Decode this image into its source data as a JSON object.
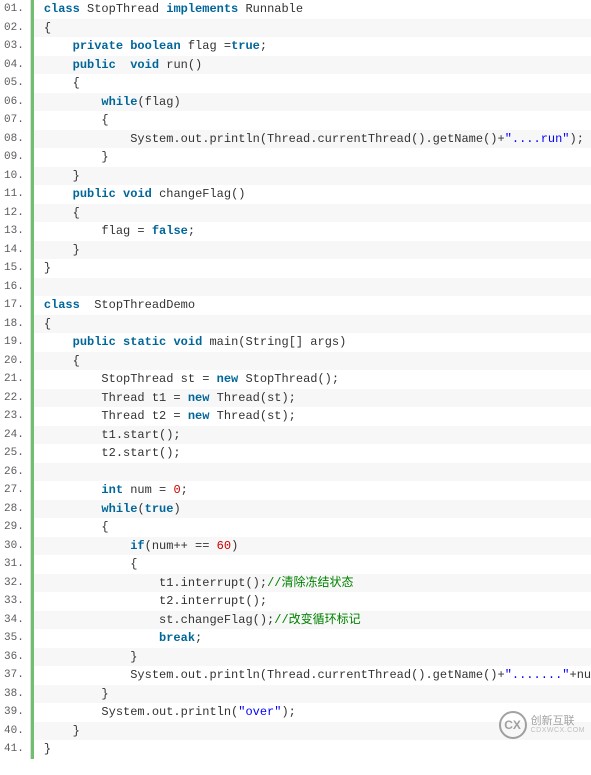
{
  "lines": [
    {
      "n": "01.",
      "tokens": [
        {
          "t": "class ",
          "c": "kw"
        },
        {
          "t": "StopThread ",
          "c": "cls"
        },
        {
          "t": "implements ",
          "c": "kw"
        },
        {
          "t": "Runnable",
          "c": "cls"
        }
      ]
    },
    {
      "n": "02.",
      "tokens": [
        {
          "t": "{",
          "c": ""
        }
      ]
    },
    {
      "n": "03.",
      "tokens": [
        {
          "t": "    ",
          "c": ""
        },
        {
          "t": "private ",
          "c": "kw"
        },
        {
          "t": "boolean ",
          "c": "type"
        },
        {
          "t": "flag =",
          "c": ""
        },
        {
          "t": "true",
          "c": "kw"
        },
        {
          "t": ";",
          "c": ""
        }
      ]
    },
    {
      "n": "04.",
      "tokens": [
        {
          "t": "    ",
          "c": ""
        },
        {
          "t": "public  ",
          "c": "kw"
        },
        {
          "t": "void ",
          "c": "type"
        },
        {
          "t": "run()",
          "c": ""
        }
      ]
    },
    {
      "n": "05.",
      "tokens": [
        {
          "t": "    {",
          "c": ""
        }
      ]
    },
    {
      "n": "06.",
      "tokens": [
        {
          "t": "        ",
          "c": ""
        },
        {
          "t": "while",
          "c": "kw"
        },
        {
          "t": "(flag)",
          "c": ""
        }
      ]
    },
    {
      "n": "07.",
      "tokens": [
        {
          "t": "        {",
          "c": ""
        }
      ]
    },
    {
      "n": "08.",
      "tokens": [
        {
          "t": "            System.out.println(Thread.currentThread().getName()+",
          "c": ""
        },
        {
          "t": "\"....run\"",
          "c": "str"
        },
        {
          "t": ");",
          "c": ""
        }
      ]
    },
    {
      "n": "09.",
      "tokens": [
        {
          "t": "        }",
          "c": ""
        }
      ]
    },
    {
      "n": "10.",
      "tokens": [
        {
          "t": "    }",
          "c": ""
        }
      ]
    },
    {
      "n": "11.",
      "tokens": [
        {
          "t": "    ",
          "c": ""
        },
        {
          "t": "public ",
          "c": "kw"
        },
        {
          "t": "void ",
          "c": "type"
        },
        {
          "t": "changeFlag()",
          "c": ""
        }
      ]
    },
    {
      "n": "12.",
      "tokens": [
        {
          "t": "    {",
          "c": ""
        }
      ]
    },
    {
      "n": "13.",
      "tokens": [
        {
          "t": "        flag = ",
          "c": ""
        },
        {
          "t": "false",
          "c": "kw"
        },
        {
          "t": ";",
          "c": ""
        }
      ]
    },
    {
      "n": "14.",
      "tokens": [
        {
          "t": "    }",
          "c": ""
        }
      ]
    },
    {
      "n": "15.",
      "tokens": [
        {
          "t": "}",
          "c": ""
        }
      ]
    },
    {
      "n": "16.",
      "tokens": [
        {
          "t": "",
          "c": ""
        }
      ]
    },
    {
      "n": "17.",
      "tokens": [
        {
          "t": "class  ",
          "c": "kw"
        },
        {
          "t": "StopThreadDemo",
          "c": "cls"
        }
      ]
    },
    {
      "n": "18.",
      "tokens": [
        {
          "t": "{",
          "c": ""
        }
      ]
    },
    {
      "n": "19.",
      "tokens": [
        {
          "t": "    ",
          "c": ""
        },
        {
          "t": "public ",
          "c": "kw"
        },
        {
          "t": "static ",
          "c": "kw"
        },
        {
          "t": "void ",
          "c": "type"
        },
        {
          "t": "main(String[] args)",
          "c": ""
        }
      ]
    },
    {
      "n": "20.",
      "tokens": [
        {
          "t": "    {",
          "c": ""
        }
      ]
    },
    {
      "n": "21.",
      "tokens": [
        {
          "t": "        StopThread st = ",
          "c": ""
        },
        {
          "t": "new ",
          "c": "kw"
        },
        {
          "t": "StopThread();",
          "c": ""
        }
      ]
    },
    {
      "n": "22.",
      "tokens": [
        {
          "t": "        Thread t1 = ",
          "c": ""
        },
        {
          "t": "new ",
          "c": "kw"
        },
        {
          "t": "Thread(st);",
          "c": ""
        }
      ]
    },
    {
      "n": "23.",
      "tokens": [
        {
          "t": "        Thread t2 = ",
          "c": ""
        },
        {
          "t": "new ",
          "c": "kw"
        },
        {
          "t": "Thread(st);",
          "c": ""
        }
      ]
    },
    {
      "n": "24.",
      "tokens": [
        {
          "t": "        t1.start();",
          "c": ""
        }
      ]
    },
    {
      "n": "25.",
      "tokens": [
        {
          "t": "        t2.start();",
          "c": ""
        }
      ]
    },
    {
      "n": "26.",
      "tokens": [
        {
          "t": "",
          "c": ""
        }
      ]
    },
    {
      "n": "27.",
      "tokens": [
        {
          "t": "        ",
          "c": ""
        },
        {
          "t": "int ",
          "c": "type"
        },
        {
          "t": "num = ",
          "c": ""
        },
        {
          "t": "0",
          "c": "num"
        },
        {
          "t": ";",
          "c": ""
        }
      ]
    },
    {
      "n": "28.",
      "tokens": [
        {
          "t": "        ",
          "c": ""
        },
        {
          "t": "while",
          "c": "kw"
        },
        {
          "t": "(",
          "c": ""
        },
        {
          "t": "true",
          "c": "kw"
        },
        {
          "t": ")",
          "c": ""
        }
      ]
    },
    {
      "n": "29.",
      "tokens": [
        {
          "t": "        {",
          "c": ""
        }
      ]
    },
    {
      "n": "30.",
      "tokens": [
        {
          "t": "            ",
          "c": ""
        },
        {
          "t": "if",
          "c": "kw"
        },
        {
          "t": "(num++ == ",
          "c": ""
        },
        {
          "t": "60",
          "c": "num"
        },
        {
          "t": ")",
          "c": ""
        }
      ]
    },
    {
      "n": "31.",
      "tokens": [
        {
          "t": "            {",
          "c": ""
        }
      ]
    },
    {
      "n": "32.",
      "tokens": [
        {
          "t": "                t1.interrupt();",
          "c": ""
        },
        {
          "t": "//清除冻结状态",
          "c": "cmt"
        }
      ]
    },
    {
      "n": "33.",
      "tokens": [
        {
          "t": "                t2.interrupt();",
          "c": ""
        }
      ]
    },
    {
      "n": "34.",
      "tokens": [
        {
          "t": "                st.changeFlag();",
          "c": ""
        },
        {
          "t": "//改变循环标记",
          "c": "cmt"
        }
      ]
    },
    {
      "n": "35.",
      "tokens": [
        {
          "t": "                ",
          "c": ""
        },
        {
          "t": "break",
          "c": "kw"
        },
        {
          "t": ";",
          "c": ""
        }
      ]
    },
    {
      "n": "36.",
      "tokens": [
        {
          "t": "            }",
          "c": ""
        }
      ]
    },
    {
      "n": "37.",
      "tokens": [
        {
          "t": "            System.out.println(Thread.currentThread().getName()+",
          "c": ""
        },
        {
          "t": "\".......\"",
          "c": "str"
        },
        {
          "t": "+num);",
          "c": ""
        }
      ]
    },
    {
      "n": "38.",
      "tokens": [
        {
          "t": "        }",
          "c": ""
        }
      ]
    },
    {
      "n": "39.",
      "tokens": [
        {
          "t": "        System.out.println(",
          "c": ""
        },
        {
          "t": "\"over\"",
          "c": "str"
        },
        {
          "t": ");",
          "c": ""
        }
      ]
    },
    {
      "n": "40.",
      "tokens": [
        {
          "t": "    }",
          "c": ""
        }
      ]
    },
    {
      "n": "41.",
      "tokens": [
        {
          "t": "}",
          "c": ""
        }
      ]
    }
  ],
  "watermark": {
    "logo_text": "CX",
    "main": "创新互联",
    "sub": "CDXWCX.COM"
  }
}
